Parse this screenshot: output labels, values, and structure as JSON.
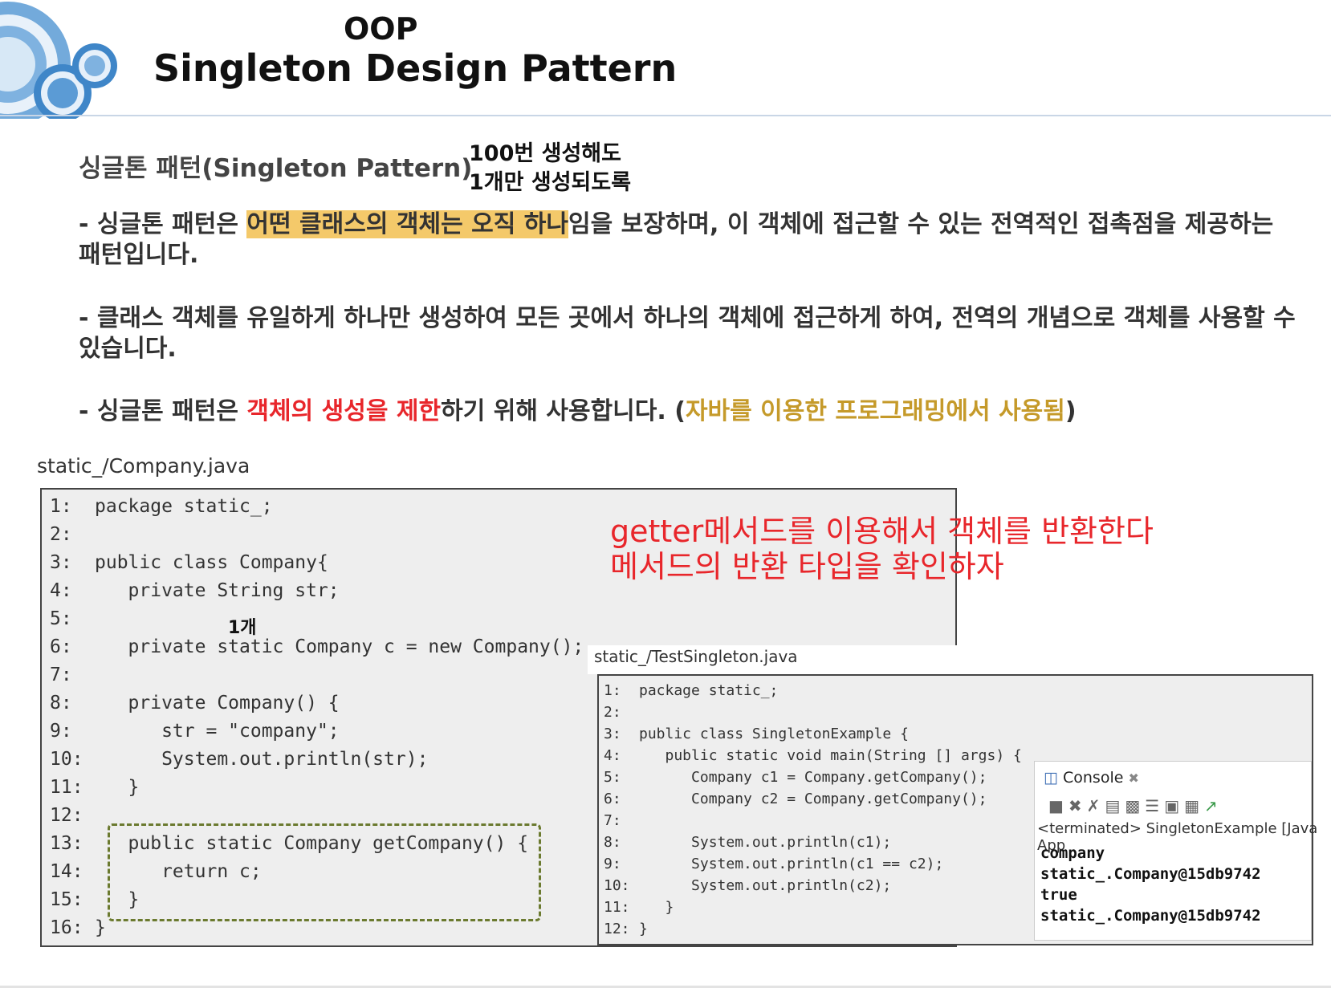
{
  "header": {
    "title_line1": "OOP",
    "title_line2": "Singleton Design Pattern"
  },
  "subtitle": "싱글톤 패턴(Singleton Pattern)",
  "note": {
    "line1": "100번 생성해도",
    "line2": "1개만 생성되도록"
  },
  "paragraphs": {
    "p1_prefix": "- 싱글톤 패턴은 ",
    "p1_highlight": "어떤 클래스의 객체는 오직 하나",
    "p1_suffix": "임을 보장하며, 이 객체에 접근할 수 있는 전역적인 접촉점을 제공하는 패턴입니다.",
    "p2": "- 클래스 객체를 유일하게 하나만 생성하여 모든 곳에서 하나의 객체에 접근하게 하여, 전역의 개념으로 객체를 사용할 수 있습니다.",
    "p3_prefix": "- 싱글톤 패턴은 ",
    "p3_red": "객체의 생성을 제한",
    "p3_mid": "하기 위해 사용합니다. (",
    "p3_gold": "자바를 이용한 프로그래밍에서 사용됨",
    "p3_suffix": ")"
  },
  "file1": {
    "caption": "static_/Company.java",
    "lines": [
      {
        "num": "1:",
        "text": "package static_;"
      },
      {
        "num": "2:",
        "text": ""
      },
      {
        "num": "3:",
        "text": "public class Company{"
      },
      {
        "num": "4:",
        "text": "   private String str;"
      },
      {
        "num": "5:",
        "text": ""
      },
      {
        "num": "6:",
        "text": "   private static Company c = new Company();"
      },
      {
        "num": "7:",
        "text": ""
      },
      {
        "num": "8:",
        "text": "   private Company() {"
      },
      {
        "num": "9:",
        "text": "      str = \"company\";"
      },
      {
        "num": "10:",
        "text": "      System.out.println(str);"
      },
      {
        "num": "11:",
        "text": "   }"
      },
      {
        "num": "12:",
        "text": ""
      },
      {
        "num": "13:",
        "text": "   public static Company getCompany() {"
      },
      {
        "num": "14:",
        "text": "      return c;"
      },
      {
        "num": "15:",
        "text": "   }"
      },
      {
        "num": "16:",
        "text": "}"
      }
    ],
    "count_label": "1개"
  },
  "getter_note": {
    "line1": "getter메서드를 이용해서 객체를 반환한다",
    "line2": "메서드의 반환 타입을 확인하자"
  },
  "file2": {
    "caption": "static_/TestSingleton.java",
    "lines": [
      {
        "num": "1:",
        "text": "package static_;"
      },
      {
        "num": "2:",
        "text": ""
      },
      {
        "num": "3:",
        "text": "public class SingletonExample {"
      },
      {
        "num": "4:",
        "text": "   public static void main(String [] args) {"
      },
      {
        "num": "5:",
        "text": "      Company c1 = Company.getCompany();"
      },
      {
        "num": "6:",
        "text": "      Company c2 = Company.getCompany();"
      },
      {
        "num": "7:",
        "text": ""
      },
      {
        "num": "8:",
        "text": "      System.out.println(c1);"
      },
      {
        "num": "9:",
        "text": "      System.out.println(c1 == c2);"
      },
      {
        "num": "10:",
        "text": "      System.out.println(c2);"
      },
      {
        "num": "11:",
        "text": "   }"
      },
      {
        "num": "12:",
        "text": "}"
      }
    ]
  },
  "console": {
    "tab_label": "Console",
    "status": "<terminated> SingletonExample [Java App",
    "output": [
      "company",
      "static_.Company@15db9742",
      "true",
      "static_.Company@15db9742"
    ]
  },
  "colors": {
    "highlight": "#f4c96a",
    "red": "#e8262b",
    "gold": "#c59a2a",
    "deco_blue": "#4a90d0"
  }
}
